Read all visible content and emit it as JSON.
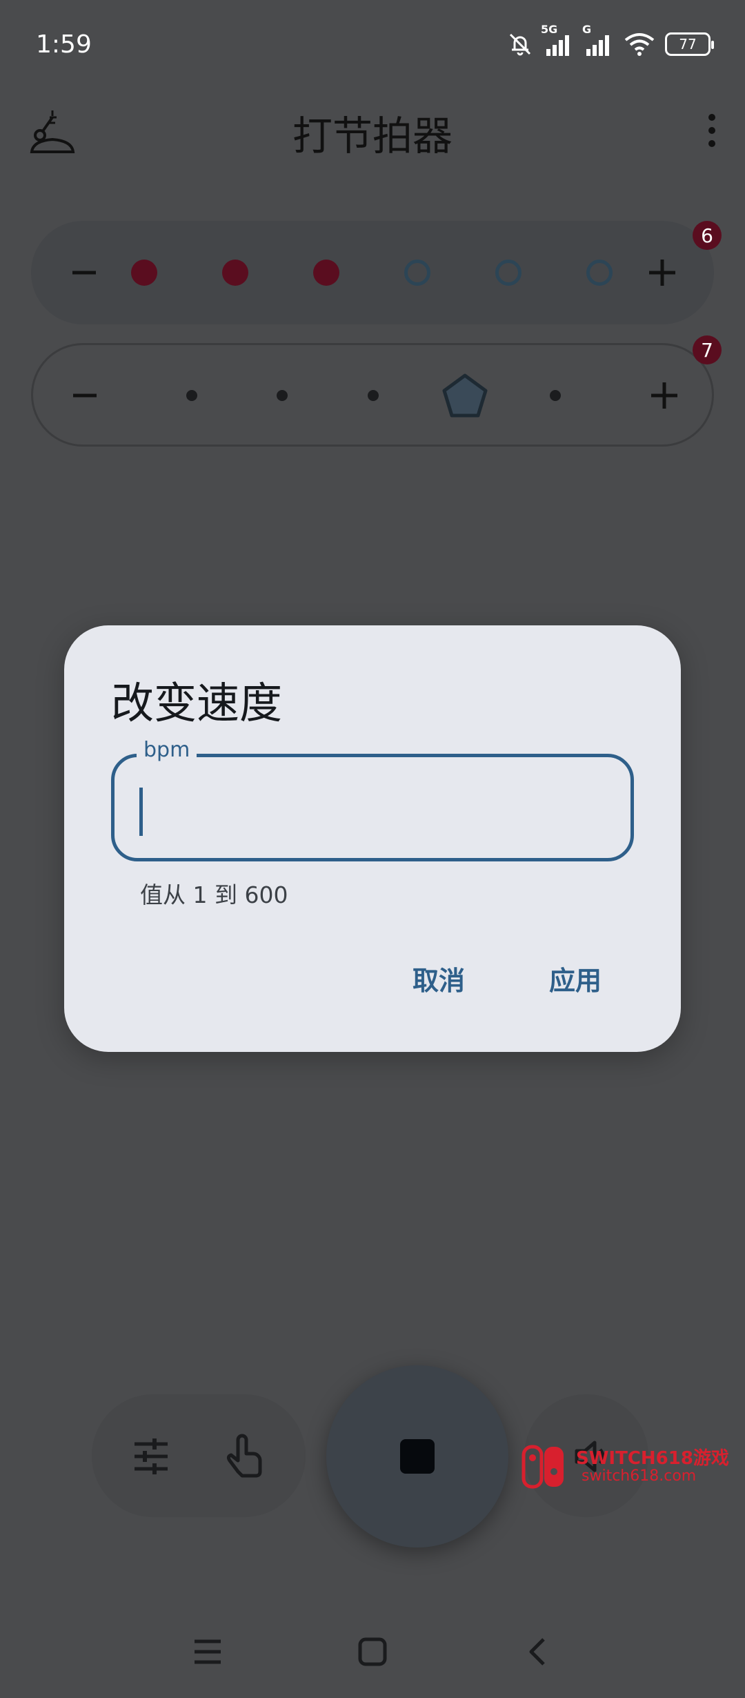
{
  "status_bar": {
    "time": "1:59",
    "network": "5G",
    "network2": "G",
    "battery": "77"
  },
  "app_bar": {
    "title": "打节拍器",
    "logo_icon": "metronome-logo-icon",
    "menu_icon": "more-vert-icon"
  },
  "beat_rows": [
    {
      "badge": "6",
      "minus_icon": "minus-icon",
      "plus_icon": "plus-icon",
      "accent_color": "#5a0d1f"
    },
    {
      "badge": "7",
      "minus_icon": "minus-icon",
      "plus_icon": "plus-icon"
    }
  ],
  "dialog": {
    "title": "改变速度",
    "field_label": "bpm",
    "field_value": "",
    "helper_text": "值从 1 到 600",
    "cancel_label": "取消",
    "apply_label": "应用",
    "accent_color": "#2e5f8a"
  },
  "bottom_controls": {
    "settings_icon": "tune-icon",
    "tap_icon": "touch-icon",
    "stop_icon": "stop-icon",
    "sound_icon": "volume-icon"
  },
  "watermark": {
    "line1": "SWITCH618游戏",
    "line2": "switch618.com"
  },
  "nav_bar": {
    "menu_icon": "menu-icon",
    "home_icon": "home-icon",
    "back_icon": "back-icon"
  }
}
